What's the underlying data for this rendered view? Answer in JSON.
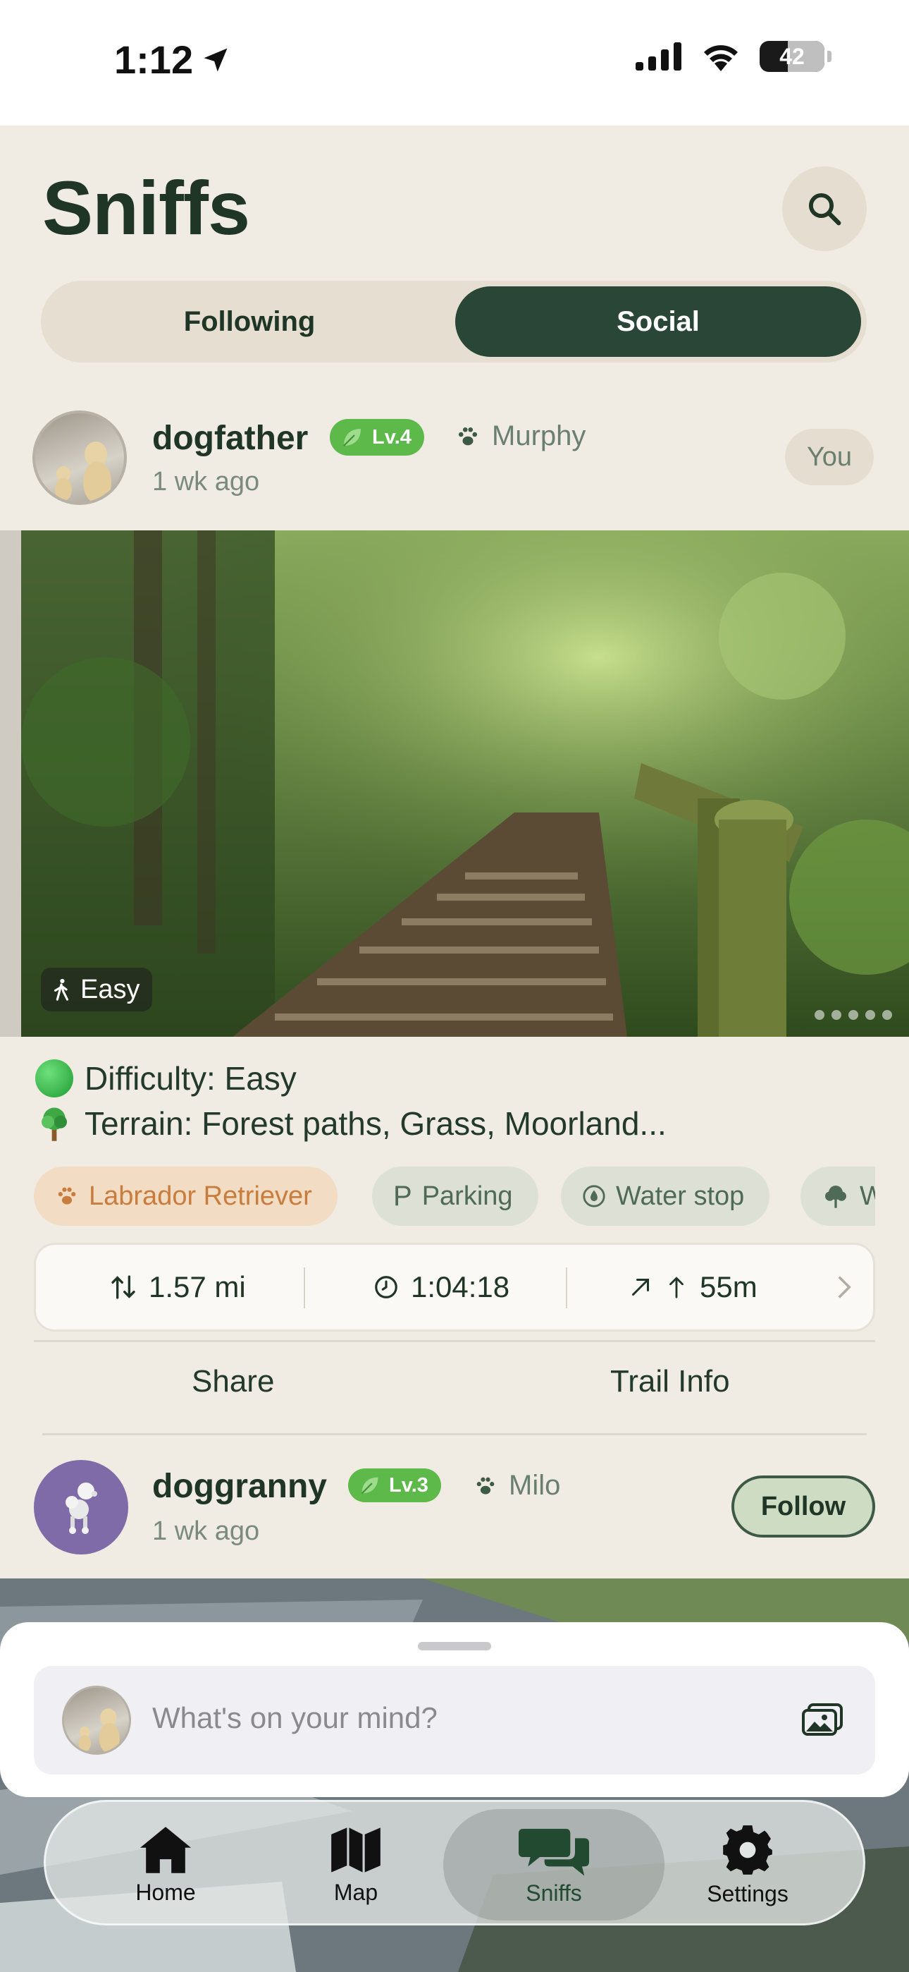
{
  "status": {
    "time": "1:12",
    "battery": "42"
  },
  "header": {
    "title": "Sniffs"
  },
  "tabs": {
    "following": "Following",
    "social": "Social"
  },
  "post1": {
    "username": "dogfather",
    "level": "Lv.4",
    "pet": "Murphy",
    "time_ago": "1 wk ago",
    "self_label": "You",
    "photo_badge": "Easy",
    "difficulty": "Difficulty: Easy",
    "terrain": "Terrain: Forest paths, Grass, Moorland...",
    "chips": [
      {
        "label": "Labrador Retriever",
        "icon": "paw-icon"
      },
      {
        "label": "Parking",
        "icon": "parking-icon"
      },
      {
        "label": "Water stop",
        "icon": "water-drop-icon"
      },
      {
        "label": "Woodland",
        "icon": "tree-icon"
      }
    ],
    "stats": {
      "distance": "1.57 mi",
      "duration": "1:04:18",
      "elevation": "55m"
    },
    "actions": {
      "share": "Share",
      "trail_info": "Trail Info"
    }
  },
  "post2": {
    "username": "doggranny",
    "level": "Lv.3",
    "pet": "Milo",
    "time_ago": "1 wk ago",
    "follow_label": "Follow"
  },
  "composer": {
    "placeholder": "What's on your mind?"
  },
  "tabbar": {
    "items": [
      {
        "label": "Home",
        "icon": "home-icon"
      },
      {
        "label": "Map",
        "icon": "map-icon"
      },
      {
        "label": "Sniffs",
        "icon": "chat-bubbles-icon",
        "active": true
      },
      {
        "label": "Settings",
        "icon": "gear-icon"
      }
    ]
  },
  "colors": {
    "primary": "#2a4636",
    "level_green": "#5db949",
    "background": "#f1ece3",
    "breed_chip": "#f2dcc4",
    "breed_text": "#c97d3d"
  }
}
